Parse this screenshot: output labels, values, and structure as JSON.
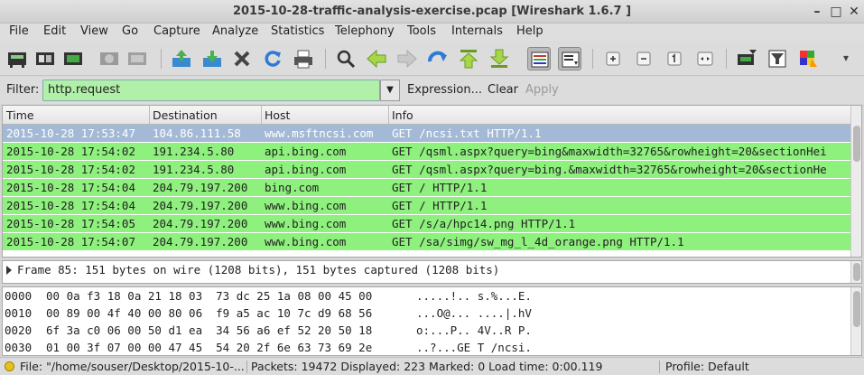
{
  "window": {
    "title": "2015-10-28-traffic-analysis-exercise.pcap  [Wireshark 1.6.7 ]",
    "minimize": "–",
    "maximize": "□",
    "close": "✕"
  },
  "menu": [
    "File",
    "Edit",
    "View",
    "Go",
    "Capture",
    "Analyze",
    "Statistics",
    "Telephony",
    "Tools",
    "Internals",
    "Help"
  ],
  "toolbar": {
    "icons": [
      "interface-list-icon",
      "capture-options-icon",
      "start-capture-icon",
      "stop-capture-icon",
      "restart-capture-icon",
      "open-file-icon",
      "save-file-icon",
      "close-file-icon",
      "reload-icon",
      "print-icon",
      "find-icon",
      "back-icon",
      "forward-icon",
      "go-to-packet-icon",
      "first-packet-icon",
      "last-packet-icon",
      "colorize-icon",
      "auto-scroll-icon",
      "zoom-in-icon",
      "zoom-out-icon",
      "normal-size-icon",
      "resize-columns-icon",
      "capture-filters-icon",
      "display-filters-icon",
      "coloring-rules-icon",
      "preferences-icon"
    ],
    "more": "▾"
  },
  "filter": {
    "label": "Filter:",
    "value": "http.request",
    "expression": "Expression...",
    "clear": "Clear",
    "apply": "Apply"
  },
  "packet_list": {
    "columns": [
      "Time",
      "Destination",
      "Host",
      "Info"
    ],
    "rows": [
      {
        "time": "2015-10-28 17:53:47",
        "dst": "104.86.111.58",
        "host": "www.msftncsi.com",
        "info": "GET /ncsi.txt HTTP/1.1",
        "selected": true
      },
      {
        "time": "2015-10-28 17:54:02",
        "dst": "191.234.5.80",
        "host": "api.bing.com",
        "info": "GET /qsml.aspx?query=bing&maxwidth=32765&rowheight=20&sectionHei"
      },
      {
        "time": "2015-10-28 17:54:02",
        "dst": "191.234.5.80",
        "host": "api.bing.com",
        "info": "GET /qsml.aspx?query=bing.&maxwidth=32765&rowheight=20&sectionHe"
      },
      {
        "time": "2015-10-28 17:54:04",
        "dst": "204.79.197.200",
        "host": "bing.com",
        "info": "GET / HTTP/1.1"
      },
      {
        "time": "2015-10-28 17:54:04",
        "dst": "204.79.197.200",
        "host": "www.bing.com",
        "info": "GET / HTTP/1.1"
      },
      {
        "time": "2015-10-28 17:54:05",
        "dst": "204.79.197.200",
        "host": "www.bing.com",
        "info": "GET /s/a/hpc14.png HTTP/1.1"
      },
      {
        "time": "2015-10-28 17:54:07",
        "dst": "204.79.197.200",
        "host": "www.bing.com",
        "info": "GET /sa/simg/sw_mg_l_4d_orange.png HTTP/1.1"
      }
    ],
    "colors": {
      "selected_bg": "#a4b9d6",
      "http_bg": "#8ef07d"
    }
  },
  "packet_details": {
    "frame": "Frame 85: 151 bytes on wire (1208 bits), 151 bytes captured (1208 bits)"
  },
  "packet_bytes": [
    {
      "offset": "0000",
      "hex": "00 0a f3 18 0a 21 18 03  73 dc 25 1a 08 00 45 00",
      "ascii": ".....!.. s.%...E."
    },
    {
      "offset": "0010",
      "hex": "00 89 00 4f 40 00 80 06  f9 a5 ac 10 7c d9 68 56",
      "ascii": "...O@... ....|.hV"
    },
    {
      "offset": "0020",
      "hex": "6f 3a c0 06 00 50 d1 ea  34 56 a6 ef 52 20 50 18",
      "ascii": "o:...P.. 4V..R P."
    },
    {
      "offset": "0030",
      "hex": "01 00 3f 07 00 00 47 45  54 20 2f 6e 63 73 69 2e",
      "ascii": "..?...GE T /ncsi."
    }
  ],
  "status": {
    "file": "File: \"/home/souser/Desktop/2015-10-...",
    "packets": "Packets: 19472 Displayed: 223 Marked: 0 Load time: 0:00.119",
    "profile": "Profile: Default"
  }
}
